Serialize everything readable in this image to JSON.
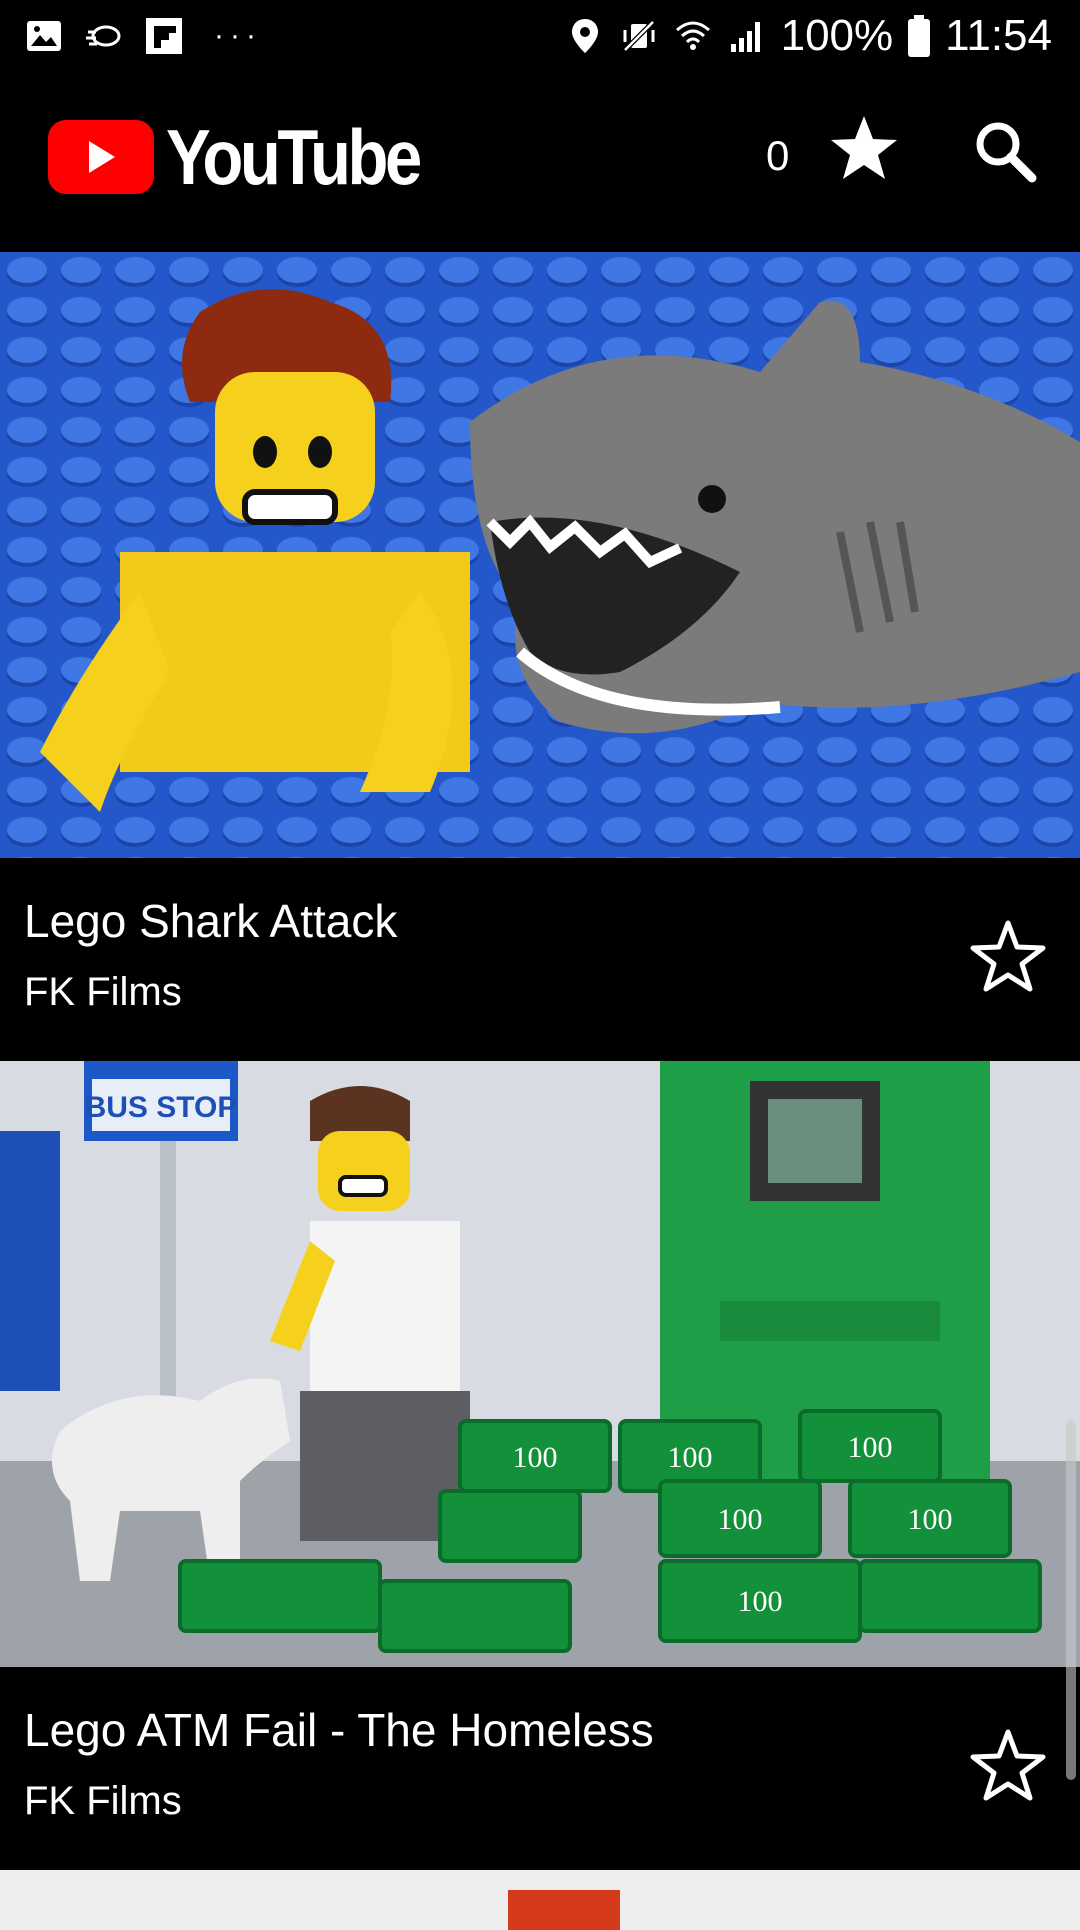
{
  "status_bar": {
    "battery": "100%",
    "time": "11:54",
    "more": "···"
  },
  "header": {
    "brand": "YouTube",
    "favorites_count": "0"
  },
  "videos": [
    {
      "title": "Lego Shark Attack",
      "channel": "FK Films"
    },
    {
      "title": "Lego ATM Fail - The Homeless",
      "channel": "FK Films"
    }
  ],
  "thumb1_text": [],
  "thumb2_text": {
    "sign": "BUS STOP",
    "notes": [
      "100",
      "100",
      "100",
      "100",
      "100",
      "100"
    ]
  },
  "colors": {
    "background": "#000000",
    "brand_red": "#ff0000",
    "text": "#ffffff"
  }
}
